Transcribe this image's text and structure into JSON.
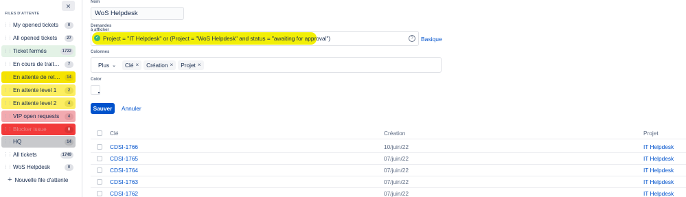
{
  "sidebar": {
    "close_icon": "×",
    "section_title": "FILES D'ATTENTE",
    "queues": [
      {
        "label": "My opened tickets",
        "count": "0"
      },
      {
        "label": "All opened tickets",
        "count": "27"
      },
      {
        "label": "Ticket fermés",
        "count": "1722"
      },
      {
        "label": "En cours de traitem...",
        "count": "7"
      },
      {
        "label": "En attente de retou...",
        "count": "14"
      },
      {
        "label": "En attente level 1",
        "count": "2"
      },
      {
        "label": "En attente level 2",
        "count": "4"
      },
      {
        "label": "VIP open requests",
        "count": "4"
      },
      {
        "label": "Blocker issue",
        "count": "0"
      },
      {
        "label": "HQ",
        "count": "14"
      },
      {
        "label": "All tickets",
        "count": "1749"
      },
      {
        "label": "WoS Helpdesk",
        "count": "0"
      }
    ],
    "new_queue_label": "Nouvelle file d'attente",
    "new_queue_icon": "+"
  },
  "form": {
    "name_label": "Nom",
    "name_value": "WoS Helpdesk",
    "requests_label": "Demandes à afficher",
    "jql_text": "Project = \"IT Helpdesk\" or (Project = \"WoS Helpdesk\" and status = \"awaiting for approval\")",
    "help_icon": "?",
    "basic_link": "Basique",
    "columns_label": "Colonnes",
    "more_button": "Plus",
    "chevron": "⌄",
    "column_chips": [
      "Clé",
      "Création",
      "Projet"
    ],
    "chip_remove": "×",
    "color_label": "Color",
    "save_button": "Sauver",
    "cancel_button": "Annuler"
  },
  "table": {
    "headers": {
      "key": "Clé",
      "created": "Création",
      "project": "Projet"
    },
    "rows": [
      {
        "key": "CDSI-1766",
        "created": "10/juin/22",
        "project": "IT Helpdesk"
      },
      {
        "key": "CDSI-1765",
        "created": "07/juin/22",
        "project": "IT Helpdesk"
      },
      {
        "key": "CDSI-1764",
        "created": "07/juin/22",
        "project": "IT Helpdesk"
      },
      {
        "key": "CDSI-1763",
        "created": "07/juin/22",
        "project": "IT Helpdesk"
      },
      {
        "key": "CDSI-1762",
        "created": "07/juin/22",
        "project": "IT Helpdesk"
      }
    ]
  },
  "colors": {
    "accent": "#0052cc",
    "highlight_yellow": "#f2ef07",
    "blocker_red": "#f23a3a",
    "vip_pink": "#f2aab0"
  }
}
